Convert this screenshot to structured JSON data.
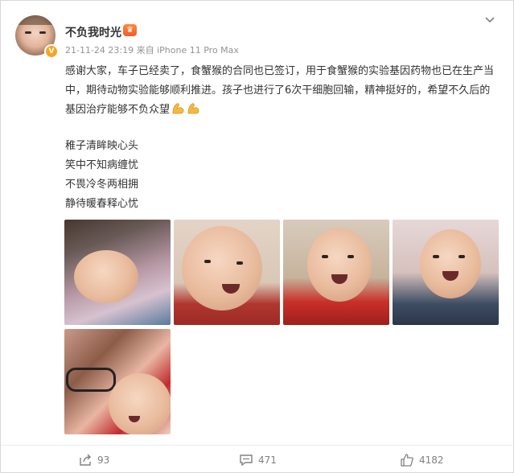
{
  "post": {
    "author": {
      "name": "不负我时光",
      "avatar_icon": "user-avatar",
      "verified_badge": "V"
    },
    "meta": "21-11-24 23:19 来自 iPhone 11 Pro Max",
    "text": "感谢大家，车子已经卖了，食蟹猴的合同也已签订，用于食蟹猴的实验基因药物也已在生产当中，期待动物实验能够顺利推进。孩子也进行了6次干细胞回输，精神挺好的，希望不久后的基因治疗能够不负众望",
    "emoji": [
      "flexed-biceps-icon",
      "flexed-biceps-icon"
    ],
    "poem": [
      "稚子清眸映心头",
      "笑中不知病缠忧",
      "不畏冷冬两相拥",
      "静待暖春释心忧"
    ],
    "photos": [
      {
        "name": "photo-baby-sleeping"
      },
      {
        "name": "photo-baby-smiling-red-sweater"
      },
      {
        "name": "photo-baby-smiling-red-coat"
      },
      {
        "name": "photo-baby-with-bib"
      },
      {
        "name": "photo-mother-and-baby"
      }
    ]
  },
  "actions": {
    "share": {
      "icon": "share-icon",
      "count": "93"
    },
    "comment": {
      "icon": "comment-icon",
      "count": "471"
    },
    "like": {
      "icon": "thumbs-up-icon",
      "count": "4182"
    }
  },
  "colors": {
    "text": "#333333",
    "meta": "#939393",
    "crown": "#f25b2a",
    "badge": "#f5a623"
  }
}
